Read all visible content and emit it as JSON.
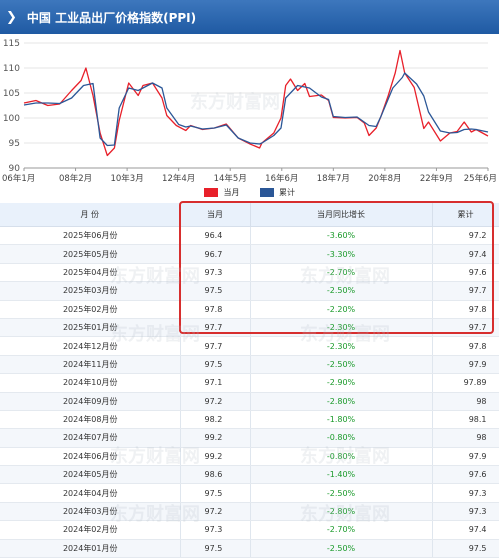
{
  "header": {
    "title": "中国 工业品出厂价格指数(PPI)",
    "chevron_icon": "chevron-right-icon"
  },
  "legend": {
    "current_label": "当月",
    "current_color": "#e8202a",
    "cumulative_label": "累计",
    "cumulative_color": "#2b5797"
  },
  "watermark": {
    "text": "东方财富网"
  },
  "chart_data": {
    "type": "line",
    "x_tick_labels": [
      "06年1月",
      "08年2月",
      "10年3月",
      "12年4月",
      "14年5月",
      "16年6月",
      "18年7月",
      "20年8月",
      "22年9月",
      "25年6月"
    ],
    "y_ticks": [
      90,
      95,
      100,
      105,
      110,
      115
    ],
    "ylim": [
      90,
      116
    ],
    "xlim": [
      2006.0,
      2025.5
    ],
    "series": [
      {
        "name": "当月",
        "color": "#e8202a",
        "x": [
          2006.0,
          2006.5,
          2007.0,
          2007.5,
          2008.0,
          2008.4,
          2008.6,
          2008.9,
          2009.2,
          2009.5,
          2009.8,
          2010.0,
          2010.4,
          2010.8,
          2011.0,
          2011.4,
          2011.8,
          2012.0,
          2012.4,
          2012.8,
          2013.0,
          2013.5,
          2014.0,
          2014.5,
          2015.0,
          2015.5,
          2015.9,
          2016.0,
          2016.5,
          2016.8,
          2017.0,
          2017.2,
          2017.5,
          2017.8,
          2018.0,
          2018.5,
          2018.8,
          2019.0,
          2019.5,
          2020.0,
          2020.3,
          2020.5,
          2020.8,
          2021.0,
          2021.3,
          2021.6,
          2021.8,
          2022.0,
          2022.4,
          2022.8,
          2023.0,
          2023.5,
          2023.9,
          2024.2,
          2024.5,
          2024.8,
          2025.0,
          2025.5
        ],
        "y": [
          103,
          103.5,
          102.5,
          102.8,
          105.5,
          107.5,
          110.0,
          104.5,
          97.0,
          92.5,
          94.0,
          99.5,
          107.0,
          104.5,
          106.5,
          107.0,
          104.0,
          100.5,
          98.5,
          97.5,
          98.5,
          97.7,
          98.0,
          98.8,
          96.0,
          94.8,
          94.0,
          95.0,
          97.0,
          100.0,
          106.5,
          107.8,
          105.5,
          106.9,
          104.3,
          104.6,
          103.5,
          100.1,
          100.0,
          100.1,
          99.0,
          96.5,
          98.0,
          100.3,
          104.4,
          109.0,
          113.5,
          109.0,
          106.1,
          97.9,
          99.2,
          95.4,
          97.0,
          97.3,
          99.2,
          97.2,
          97.7,
          96.4
        ]
      },
      {
        "name": "累计",
        "color": "#2b5797",
        "x": [
          2006.0,
          2006.5,
          2007.0,
          2007.5,
          2008.0,
          2008.5,
          2008.9,
          2009.2,
          2009.5,
          2009.8,
          2010.0,
          2010.4,
          2010.8,
          2011.0,
          2011.4,
          2011.8,
          2012.0,
          2012.5,
          2012.8,
          2013.0,
          2013.5,
          2014.0,
          2014.5,
          2015.0,
          2015.5,
          2015.9,
          2016.0,
          2016.5,
          2016.8,
          2017.0,
          2017.5,
          2018.0,
          2018.5,
          2018.8,
          2019.0,
          2019.5,
          2020.0,
          2020.5,
          2020.8,
          2021.0,
          2021.5,
          2021.9,
          2022.0,
          2022.5,
          2022.8,
          2023.0,
          2023.5,
          2023.9,
          2024.2,
          2024.5,
          2024.8,
          2025.0,
          2025.5
        ],
        "y": [
          102.6,
          103.0,
          103.0,
          102.9,
          104.0,
          106.5,
          106.9,
          96.0,
          94.5,
          94.6,
          102.0,
          106.0,
          105.5,
          106.0,
          107.0,
          106.0,
          102.0,
          98.7,
          98.2,
          98.4,
          97.8,
          98.0,
          98.6,
          96.0,
          95.0,
          94.8,
          95.0,
          96.5,
          98.0,
          104.0,
          106.5,
          106.0,
          104.2,
          103.7,
          100.3,
          100.1,
          100.2,
          98.5,
          98.3,
          100.3,
          106.0,
          108.1,
          109.0,
          106.8,
          104.4,
          101.2,
          97.4,
          97.0,
          97.1,
          97.7,
          97.8,
          97.7,
          97.2
        ]
      }
    ]
  },
  "table": {
    "headers": [
      "月  份",
      "当月",
      "当月同比增长",
      "累计"
    ],
    "rows": [
      [
        "2025年06月份",
        "96.4",
        "-3.60%",
        "97.2"
      ],
      [
        "2025年05月份",
        "96.7",
        "-3.30%",
        "97.4"
      ],
      [
        "2025年04月份",
        "97.3",
        "-2.70%",
        "97.6"
      ],
      [
        "2025年03月份",
        "97.5",
        "-2.50%",
        "97.7"
      ],
      [
        "2025年02月份",
        "97.8",
        "-2.20%",
        "97.8"
      ],
      [
        "2025年01月份",
        "97.7",
        "-2.30%",
        "97.7"
      ],
      [
        "2024年12月份",
        "97.7",
        "-2.30%",
        "97.8"
      ],
      [
        "2024年11月份",
        "97.5",
        "-2.50%",
        "97.9"
      ],
      [
        "2024年10月份",
        "97.1",
        "-2.90%",
        "97.89"
      ],
      [
        "2024年09月份",
        "97.2",
        "-2.80%",
        "98"
      ],
      [
        "2024年08月份",
        "98.2",
        "-1.80%",
        "98.1"
      ],
      [
        "2024年07月份",
        "99.2",
        "-0.80%",
        "98"
      ],
      [
        "2024年06月份",
        "99.2",
        "-0.80%",
        "97.9"
      ],
      [
        "2024年05月份",
        "98.6",
        "-1.40%",
        "97.6"
      ],
      [
        "2024年04月份",
        "97.5",
        "-2.50%",
        "97.3"
      ],
      [
        "2024年03月份",
        "97.2",
        "-2.80%",
        "97.3"
      ],
      [
        "2024年02月份",
        "97.3",
        "-2.70%",
        "97.4"
      ],
      [
        "2024年01月份",
        "97.5",
        "-2.50%",
        "97.5"
      ]
    ]
  }
}
